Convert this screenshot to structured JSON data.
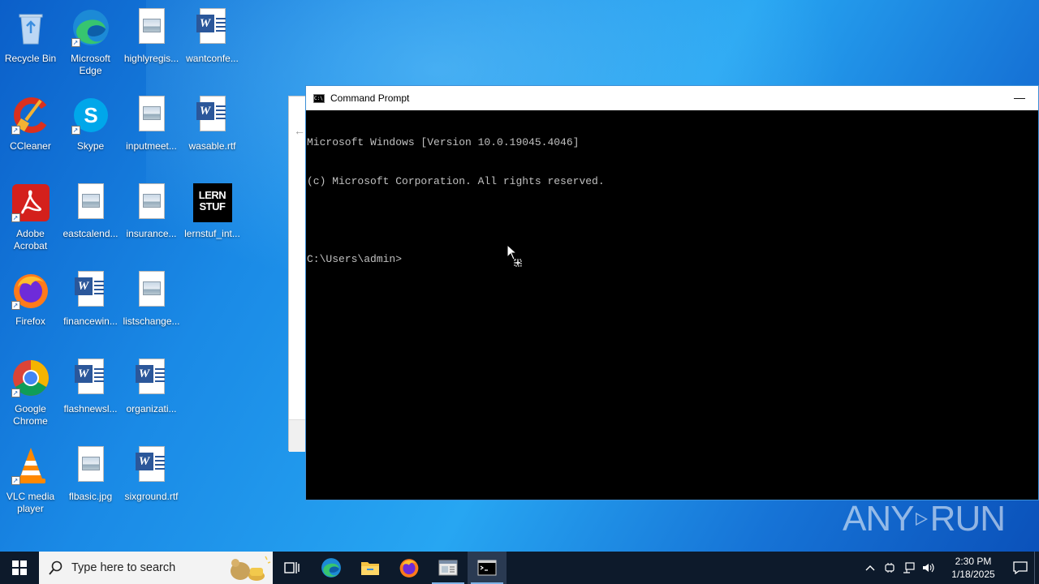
{
  "desktop": {
    "icons": [
      {
        "label": "Recycle Bin",
        "icon": "recycle-bin-icon"
      },
      {
        "label": "Microsoft Edge",
        "icon": "edge-icon"
      },
      {
        "label": "highlyregis...",
        "icon": "image-file-icon"
      },
      {
        "label": "wantconfe...",
        "icon": "word-doc-icon"
      },
      {
        "label": "CCleaner",
        "icon": "ccleaner-icon"
      },
      {
        "label": "Skype",
        "icon": "skype-icon"
      },
      {
        "label": "inputmeet...",
        "icon": "image-file-icon"
      },
      {
        "label": "wasable.rtf",
        "icon": "word-doc-icon"
      },
      {
        "label": "Adobe Acrobat",
        "icon": "acrobat-icon"
      },
      {
        "label": "eastcalend...",
        "icon": "image-file-icon"
      },
      {
        "label": "insurance...",
        "icon": "image-file-icon"
      },
      {
        "label": "lernstuf_int...",
        "icon": "lernstuf-thumbnail-icon"
      },
      {
        "label": "Firefox",
        "icon": "firefox-icon"
      },
      {
        "label": "financewin...",
        "icon": "word-doc-icon"
      },
      {
        "label": "listschange...",
        "icon": "image-file-icon"
      },
      {
        "label": "Google Chrome",
        "icon": "chrome-icon"
      },
      {
        "label": "flashnewsl...",
        "icon": "word-doc-icon"
      },
      {
        "label": "organizati...",
        "icon": "word-doc-icon"
      },
      {
        "label": "VLC media player",
        "icon": "vlc-icon"
      },
      {
        "label": "flbasic.jpg",
        "icon": "image-file-icon"
      },
      {
        "label": "sixground.rtf",
        "icon": "word-doc-icon"
      }
    ],
    "lernstuf_text": "LERN STUF"
  },
  "cmd": {
    "title": "Command Prompt",
    "minimize": "—",
    "lines": [
      "Microsoft Windows [Version 10.0.19045.4046]",
      "(c) Microsoft Corporation. All rights reserved.",
      "",
      "C:\\Users\\admin>"
    ]
  },
  "watermark": {
    "left": "ANY",
    "right": "RUN"
  },
  "taskbar": {
    "search_placeholder": "Type here to search",
    "apps": [
      "task-view-icon",
      "edge-icon",
      "file-explorer-icon",
      "firefox-icon",
      "app-window-icon",
      "command-prompt-icon"
    ],
    "clock_time": "2:30 PM",
    "clock_date": "1/18/2025"
  },
  "colors": {
    "taskbar": "#0d1a2b",
    "console_text": "#c0c0c0",
    "accent": "#3c8fd6"
  }
}
